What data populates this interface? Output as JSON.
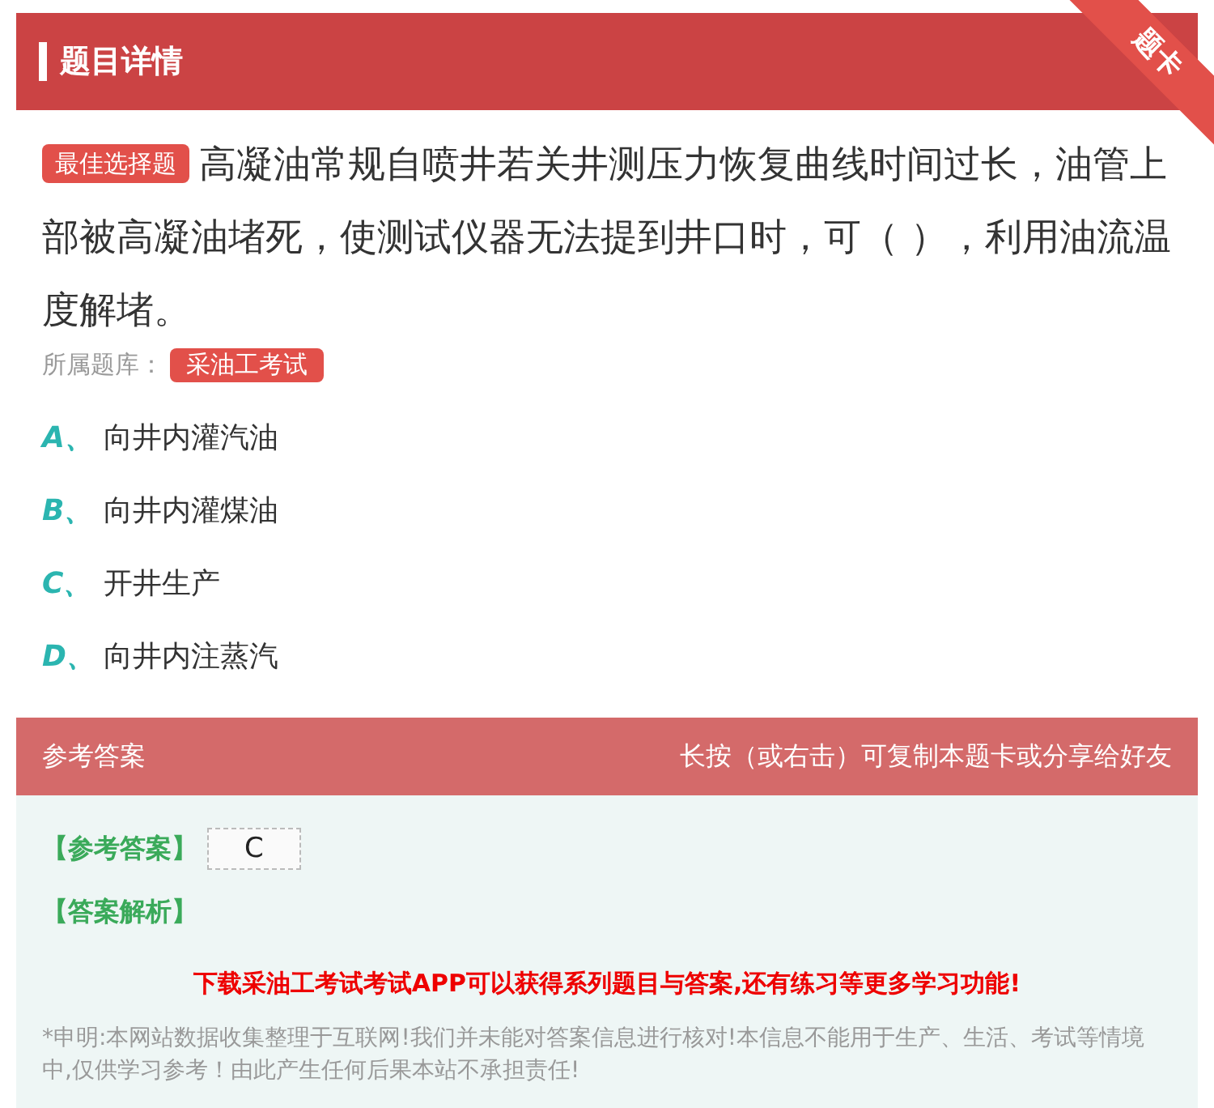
{
  "header": {
    "title": "题目详情",
    "corner_badge": "题卡"
  },
  "question": {
    "type_badge": "最佳选择题",
    "text": "高凝油常规自喷井若关井测压力恢复曲线时间过长，油管上部被高凝油堵死，使测试仪器无法提到井口时，可（ ），利用油流温度解堵。",
    "bank_label": "所属题库：",
    "bank_tag": "采油工考试"
  },
  "options": [
    {
      "letter": "A、",
      "text": "向井内灌汽油"
    },
    {
      "letter": "B、",
      "text": "向井内灌煤油"
    },
    {
      "letter": "C、",
      "text": "开井生产"
    },
    {
      "letter": "D、",
      "text": "向井内注蒸汽"
    }
  ],
  "answer_bar": {
    "title": "参考答案",
    "hint": "长按（或右击）可复制本题卡或分享给好友"
  },
  "answer": {
    "label": "【参考答案】",
    "value": "C",
    "analysis_label": "【答案解析】",
    "promo": "下载采油工考试考试APP可以获得系列题目与答案,还有练习等更多学习功能!",
    "disclaimer": "*申明:本网站数据收集整理于互联网!我们并未能对答案信息进行核对!本信息不能用于生产、生活、考试等情境中,仅供学习参考！由此产生任何后果本站不承担责任!"
  }
}
